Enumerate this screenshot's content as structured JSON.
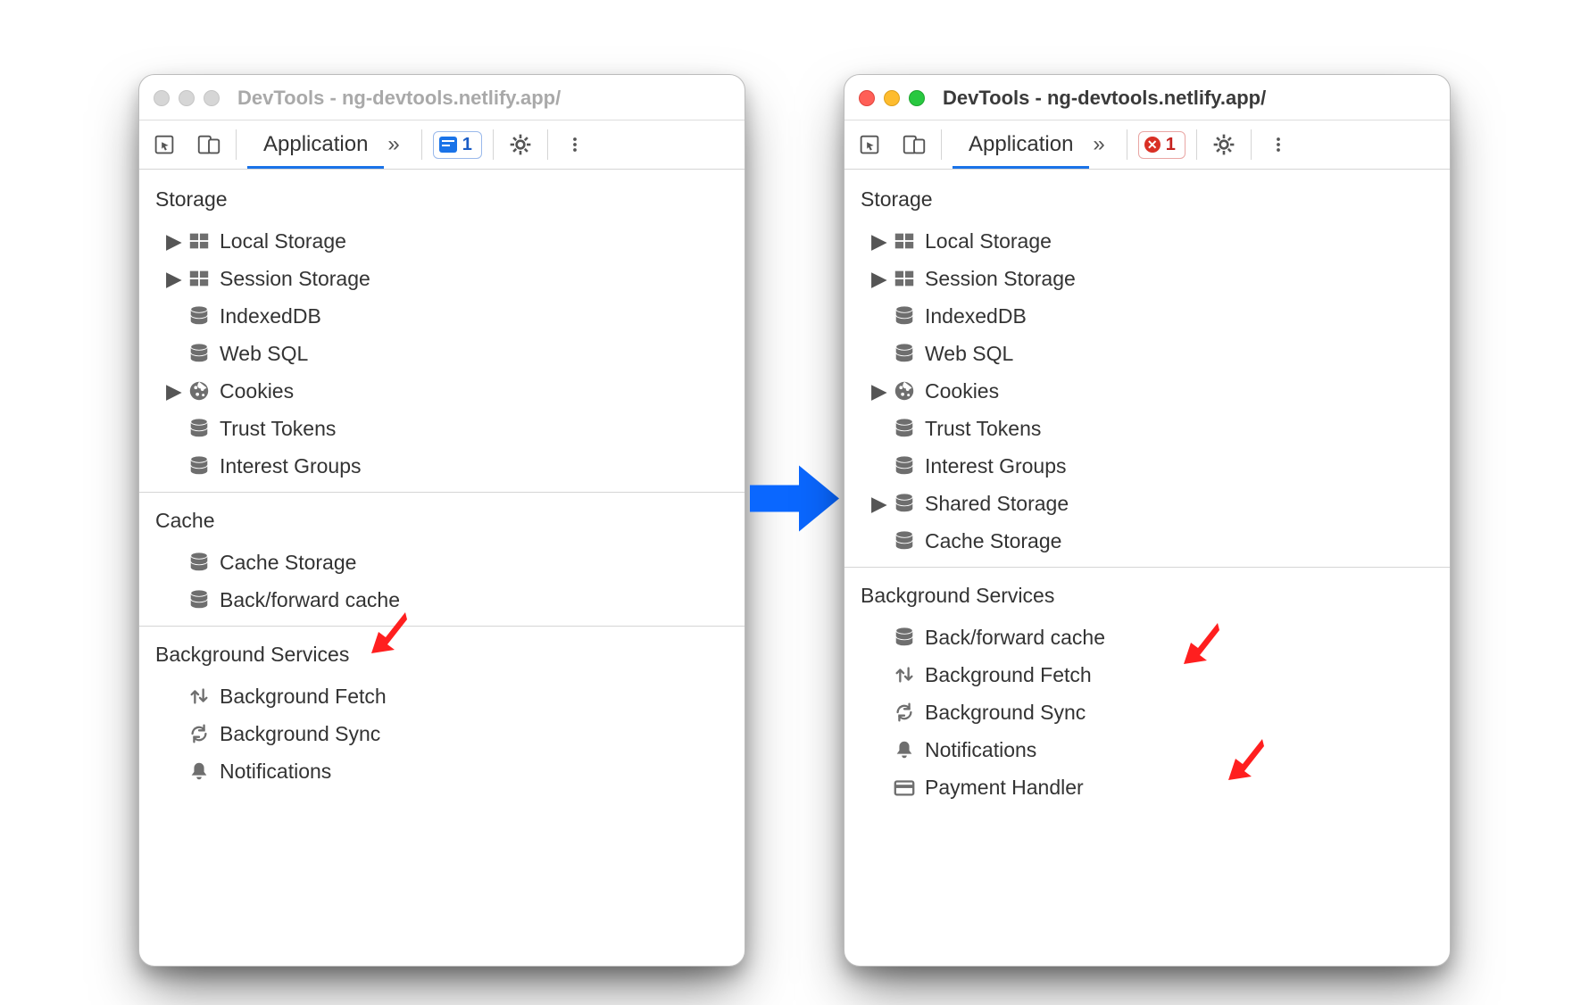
{
  "left": {
    "title": "DevTools - ng-devtools.netlify.app/",
    "tab": "Application",
    "badge_count": "1",
    "sections": [
      {
        "title": "Storage",
        "items": [
          {
            "label": "Local Storage",
            "icon": "table",
            "expandable": true
          },
          {
            "label": "Session Storage",
            "icon": "table",
            "expandable": true
          },
          {
            "label": "IndexedDB",
            "icon": "db",
            "expandable": false
          },
          {
            "label": "Web SQL",
            "icon": "db",
            "expandable": false
          },
          {
            "label": "Cookies",
            "icon": "cookie",
            "expandable": true
          },
          {
            "label": "Trust Tokens",
            "icon": "db",
            "expandable": false
          },
          {
            "label": "Interest Groups",
            "icon": "db",
            "expandable": false
          }
        ]
      },
      {
        "title": "Cache",
        "items": [
          {
            "label": "Cache Storage",
            "icon": "db",
            "expandable": false
          },
          {
            "label": "Back/forward cache",
            "icon": "db",
            "expandable": false
          }
        ]
      },
      {
        "title": "Background Services",
        "items": [
          {
            "label": "Background Fetch",
            "icon": "updown",
            "expandable": false
          },
          {
            "label": "Background Sync",
            "icon": "sync",
            "expandable": false
          },
          {
            "label": "Notifications",
            "icon": "bell",
            "expandable": false
          }
        ]
      }
    ]
  },
  "right": {
    "title": "DevTools - ng-devtools.netlify.app/",
    "tab": "Application",
    "badge_count": "1",
    "sections": [
      {
        "title": "Storage",
        "items": [
          {
            "label": "Local Storage",
            "icon": "table",
            "expandable": true
          },
          {
            "label": "Session Storage",
            "icon": "table",
            "expandable": true
          },
          {
            "label": "IndexedDB",
            "icon": "db",
            "expandable": false
          },
          {
            "label": "Web SQL",
            "icon": "db",
            "expandable": false
          },
          {
            "label": "Cookies",
            "icon": "cookie",
            "expandable": true
          },
          {
            "label": "Trust Tokens",
            "icon": "db",
            "expandable": false
          },
          {
            "label": "Interest Groups",
            "icon": "db",
            "expandable": false
          },
          {
            "label": "Shared Storage",
            "icon": "db",
            "expandable": true
          },
          {
            "label": "Cache Storage",
            "icon": "db",
            "expandable": false
          }
        ]
      },
      {
        "title": "Background Services",
        "items": [
          {
            "label": "Back/forward cache",
            "icon": "db",
            "expandable": false
          },
          {
            "label": "Background Fetch",
            "icon": "updown",
            "expandable": false
          },
          {
            "label": "Background Sync",
            "icon": "sync",
            "expandable": false
          },
          {
            "label": "Notifications",
            "icon": "bell",
            "expandable": false
          },
          {
            "label": "Payment Handler",
            "icon": "card",
            "expandable": false
          }
        ]
      }
    ]
  }
}
